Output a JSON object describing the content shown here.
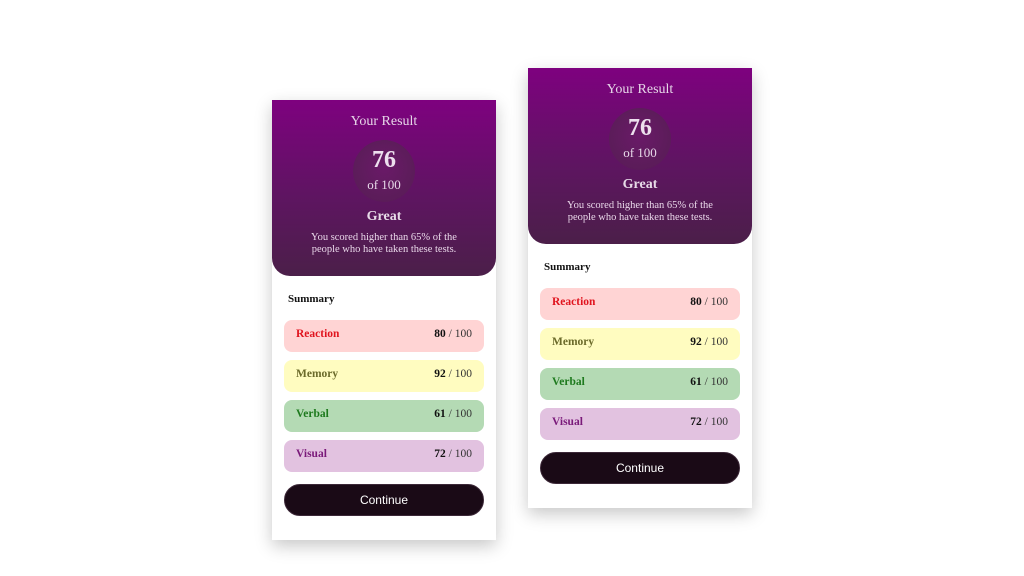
{
  "result": {
    "title": "Your Result",
    "score": "76",
    "score_max": "of 100",
    "label": "Great",
    "description": "You scored higher than 65% of the people who have taken these tests."
  },
  "summary": {
    "title": "Summary",
    "items": [
      {
        "label": "Reaction",
        "value": "80",
        "separator": "/",
        "max": "100",
        "label_color": "#e0141e",
        "bg_color": "#ffd4d4"
      },
      {
        "label": "Memory",
        "value": "92",
        "separator": "/",
        "max": "100",
        "label_color": "#6b6a2a",
        "bg_color": "#fffcc0"
      },
      {
        "label": "Verbal",
        "value": "61",
        "separator": "/",
        "max": "100",
        "label_color": "#1e7a1e",
        "bg_color": "#b4dab4"
      },
      {
        "label": "Visual",
        "value": "72",
        "separator": "/",
        "max": "100",
        "label_color": "#7a1a7a",
        "bg_color": "#e2c2e0"
      }
    ]
  },
  "actions": {
    "continue_label": "Continue"
  },
  "colors": {
    "header_top": "#7e017f",
    "header_bottom": "#4b1f49",
    "button_bg": "#1a0a16"
  }
}
